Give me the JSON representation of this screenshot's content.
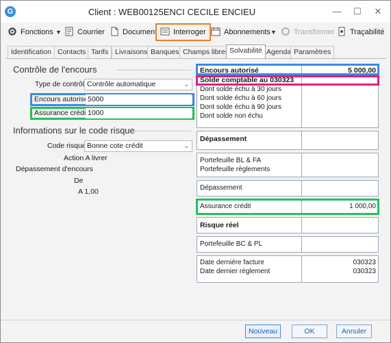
{
  "window": {
    "title": "Client : WEB00125ENCI CECILE ENCIEU",
    "minimize": "—",
    "maximize": "☐",
    "close": "✕"
  },
  "toolbar": {
    "fonctions": "Fonctions",
    "courrier": "Courrier",
    "document": "Document",
    "interroger": "Interroger",
    "abonnements": "Abonnements",
    "transformer": "Transformer",
    "tracabilite": "Traçabilité"
  },
  "tabs": [
    "Identification",
    "Contacts",
    "Tarifs",
    "Livraisons",
    "Banques",
    "Champs libres",
    "Solvabilité",
    "Agenda",
    "Paramètres"
  ],
  "controle": {
    "title": "Contrôle de l'encours",
    "type_label": "Type de contrôle",
    "type_value": "Contrôle automatique",
    "encours_label": "Encours autorisé",
    "encours_value": "5000",
    "assurance_label": "Assurance crédit",
    "assurance_value": "1000"
  },
  "risque": {
    "title": "Informations sur le code risque",
    "code_label": "Code risque",
    "code_value": "Bonne cote crédit",
    "action": "Action A livrer",
    "depassement": "Dépassement d'encours",
    "de": "De",
    "a": "A 1,00"
  },
  "summary": {
    "encours_autorise": "Encours autorisé",
    "encours_autorise_value": "5 000,00",
    "solde_comptable": "Solde comptable au 030323",
    "echu30": "Dont solde échu à 30 jours",
    "echu60": "Dont solde échu à 60 jours",
    "echu90": "Dont solde échu à 90 jours",
    "non_echu": "Dont solde non échu",
    "depassement_title": "Dépassement",
    "portefeuille_bl": "Portefeuille BL & FA",
    "portefeuille_reglements": "Portefeuille règlements",
    "depassement": "Dépassement",
    "assurance_credit": "Assurance crédit",
    "assurance_credit_value": "1 000,00",
    "risque_reel": "Risque réel",
    "portefeuille_bc": "Portefeuille BC & PL",
    "date_facture": "Date dernière facture",
    "date_facture_value": "030323",
    "date_reglement": "Date dernier règlement",
    "date_reglement_value": "030323"
  },
  "buttons": {
    "nouveau": "Nouveau",
    "ok": "OK",
    "annuler": "Annuler"
  },
  "colors": {
    "highlight_blue": "#3b8ae6",
    "highlight_green": "#22c25a",
    "highlight_pink": "#e0207a",
    "highlight_orange": "#ef7d22"
  }
}
